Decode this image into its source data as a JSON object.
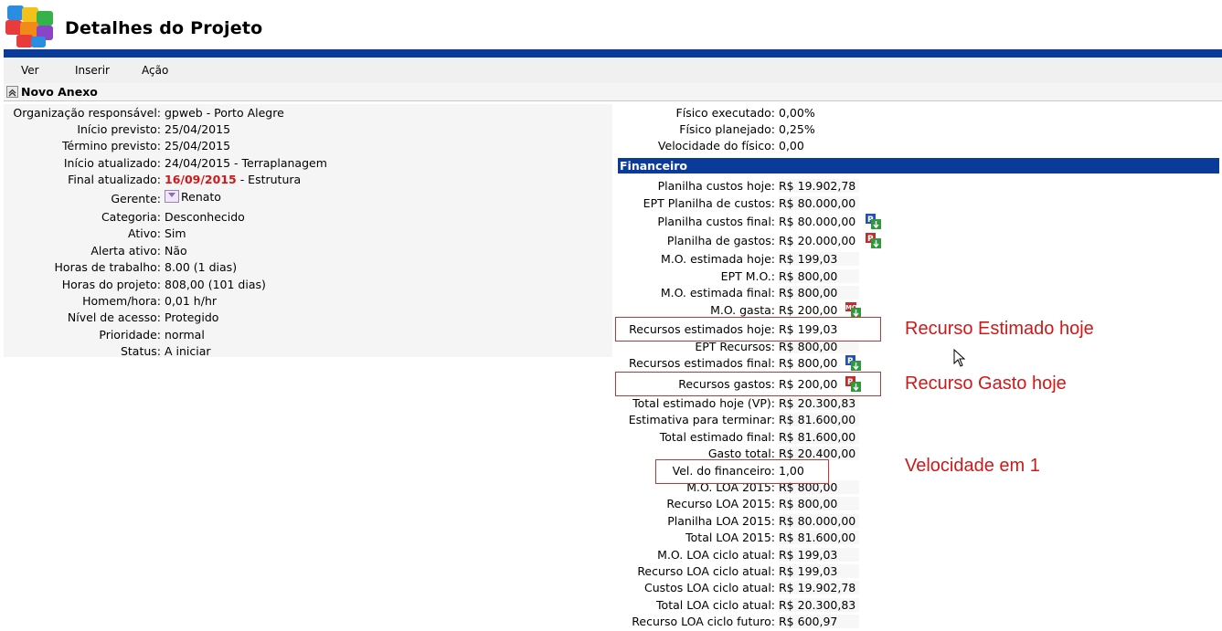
{
  "header": {
    "title": "Detalhes do Projeto"
  },
  "menu": {
    "items": [
      "Ver",
      "Inserir",
      "Ação"
    ]
  },
  "section": {
    "title": "Novo Anexo"
  },
  "details": [
    {
      "label": "Organização responsável:",
      "value": "gpweb - Porto Alegre"
    },
    {
      "label": "Início previsto:",
      "value": "25/04/2015"
    },
    {
      "label": "Término previsto:",
      "value": "25/04/2015"
    },
    {
      "label": "Início atualizado:",
      "value": "24/04/2015 - Terraplanagem"
    },
    {
      "label": "Final atualizado:",
      "value_highlight": "16/09/2015",
      "value_rest": " - Estrutura"
    },
    {
      "label": "Gerente:",
      "value": "Renato"
    },
    {
      "label": "Categoria:",
      "value": "Desconhecido"
    },
    {
      "label": "Ativo:",
      "value": "Sim"
    },
    {
      "label": "Alerta ativo:",
      "value": "Não"
    },
    {
      "label": "Horas de trabalho:",
      "value": "8.00 (1 dias)"
    },
    {
      "label": "Horas do projeto:",
      "value": "808,00 (101 dias)"
    },
    {
      "label": "Homem/hora:",
      "value": "0,01 h/hr"
    },
    {
      "label": "Nível de acesso:",
      "value": "Protegido"
    },
    {
      "label": "Prioridade:",
      "value": "normal"
    },
    {
      "label": "Status:",
      "value": "A iniciar"
    }
  ],
  "physical": [
    {
      "label": "Físico executado:",
      "value": "0,00%"
    },
    {
      "label": "Físico planejado:",
      "value": "0,25%"
    },
    {
      "label": "Velocidade do físico:",
      "value": "0,00"
    }
  ],
  "financial": {
    "title": "Financeiro",
    "rows": [
      {
        "label": "Planilha custos hoje:",
        "value": "R$ 19.902,78"
      },
      {
        "label": "EPT Planilha de custos:",
        "value": "R$ 80.000,00"
      },
      {
        "label": "Planilha custos final:",
        "value": "R$ 80.000,00",
        "icon": "planilha-icon"
      },
      {
        "label": "Planilha de gastos:",
        "value": "R$ 20.000,00",
        "icon": "planilha-gastos-icon"
      },
      {
        "label": "M.O. estimada hoje:",
        "value": "R$ 199,03"
      },
      {
        "label": "EPT M.O.:",
        "value": "R$ 800,00"
      },
      {
        "label": "M.O. estimada final:",
        "value": "R$ 800,00"
      },
      {
        "label": "M.O. gasta:",
        "value": "R$ 200,00",
        "icon": "mo-icon"
      },
      {
        "label": "Recursos estimados hoje:",
        "value": "R$ 199,03"
      },
      {
        "label": "EPT Recursos:",
        "value": "R$ 800,00"
      },
      {
        "label": "Recursos estimados final:",
        "value": "R$ 800,00",
        "icon": "recurso-icon"
      },
      {
        "label": "Recursos gastos:",
        "value": "R$ 200,00",
        "icon": "recurso-gasto-icon"
      },
      {
        "label": "Total estimado hoje (VP):",
        "value": "R$ 20.300,83"
      },
      {
        "label": "Estimativa para terminar:",
        "value": "R$ 81.600,00"
      },
      {
        "label": "Total estimado final:",
        "value": "R$ 81.600,00"
      },
      {
        "label": "Gasto total:",
        "value": "R$ 20.400,00"
      },
      {
        "label": "Vel. do financeiro:",
        "value": "1,00"
      },
      {
        "label": "M.O. LOA 2015:",
        "value": "R$ 800,00"
      },
      {
        "label": "Recurso LOA 2015:",
        "value": "R$ 800,00"
      },
      {
        "label": "Planilha LOA 2015:",
        "value": "R$ 80.000,00"
      },
      {
        "label": "Total LOA 2015:",
        "value": "R$ 81.600,00"
      },
      {
        "label": "M.O. LOA ciclo atual:",
        "value": "R$ 199,03"
      },
      {
        "label": "Recurso LOA ciclo atual:",
        "value": "R$ 199,03"
      },
      {
        "label": "Custos LOA ciclo atual:",
        "value": "R$ 19.902,78"
      },
      {
        "label": "Total LOA ciclo atual:",
        "value": "R$ 20.300,83"
      },
      {
        "label": "Recurso LOA ciclo futuro:",
        "value": "R$ 600,97"
      }
    ]
  },
  "annotations": {
    "estimado": "Recurso Estimado hoje",
    "gasto": "Recurso Gasto hoje",
    "velocidade": "Velocidade em 1"
  },
  "colors": {
    "brand_blue": "#0a3a9a",
    "annotation_red": "#d01818"
  }
}
